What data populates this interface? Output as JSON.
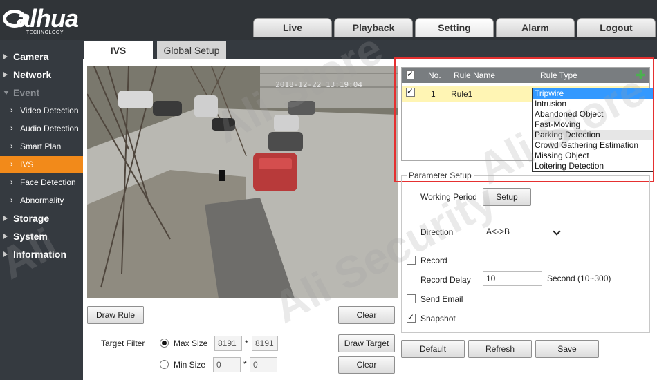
{
  "brand": {
    "logo_text": "alhua",
    "logo_sub": "TECHNOLOGY"
  },
  "nav": {
    "tabs": [
      "Live",
      "Playback",
      "Setting",
      "Alarm",
      "Logout"
    ]
  },
  "sidebar": {
    "items": [
      {
        "label": "Camera"
      },
      {
        "label": "Network"
      },
      {
        "label": "Event"
      },
      {
        "label": "Video Detection"
      },
      {
        "label": "Audio Detection"
      },
      {
        "label": "Smart Plan"
      },
      {
        "label": "IVS"
      },
      {
        "label": "Face Detection"
      },
      {
        "label": "Abnormality"
      },
      {
        "label": "Storage"
      },
      {
        "label": "System"
      },
      {
        "label": "Information"
      }
    ]
  },
  "content_tabs": {
    "ivs": "IVS",
    "global_setup": "Global Setup"
  },
  "video": {
    "timestamp": "2018-12-22 13:19:04"
  },
  "video_controls": {
    "draw_rule": "Draw Rule",
    "clear": "Clear",
    "target_filter": "Target Filter",
    "max_size": "Max Size",
    "min_size": "Min Size",
    "max_w": "8191",
    "max_h": "8191",
    "min_w": "0",
    "min_h": "0",
    "times": "*",
    "draw_target": "Draw Target",
    "clear2": "Clear"
  },
  "rules": {
    "headers": {
      "no": "No.",
      "name": "Rule Name",
      "type": "Rule Type"
    },
    "rows": [
      {
        "no": "1",
        "name": "Rule1",
        "type": "Tripwire",
        "enabled": true
      }
    ],
    "type_options": [
      "Tripwire",
      "Intrusion",
      "Abandoned Object",
      "Fast-Moving",
      "Parking Detection",
      "Crowd Gathering Estimation",
      "Missing Object",
      "Loitering Detection"
    ],
    "selected_type": "Tripwire"
  },
  "params": {
    "title": "Parameter Setup",
    "working_period": "Working Period",
    "setup": "Setup",
    "direction": "Direction",
    "direction_value": "A<->B",
    "record": "Record",
    "record_checked": false,
    "record_delay": "Record Delay",
    "record_delay_value": "10",
    "record_delay_unit": "Second (10~300)",
    "send_email": "Send Email",
    "send_email_checked": false,
    "snapshot": "Snapshot",
    "snapshot_checked": true
  },
  "footer": {
    "default": "Default",
    "refresh": "Refresh",
    "save": "Save"
  },
  "watermarks": [
    "Ali Store",
    "Ali Security",
    "Ali Store",
    "Ali"
  ],
  "colors": {
    "accent": "#f28a1a",
    "highlight": "#e53030",
    "selection": "#3399ff",
    "row_highlight": "#fff5b4"
  }
}
